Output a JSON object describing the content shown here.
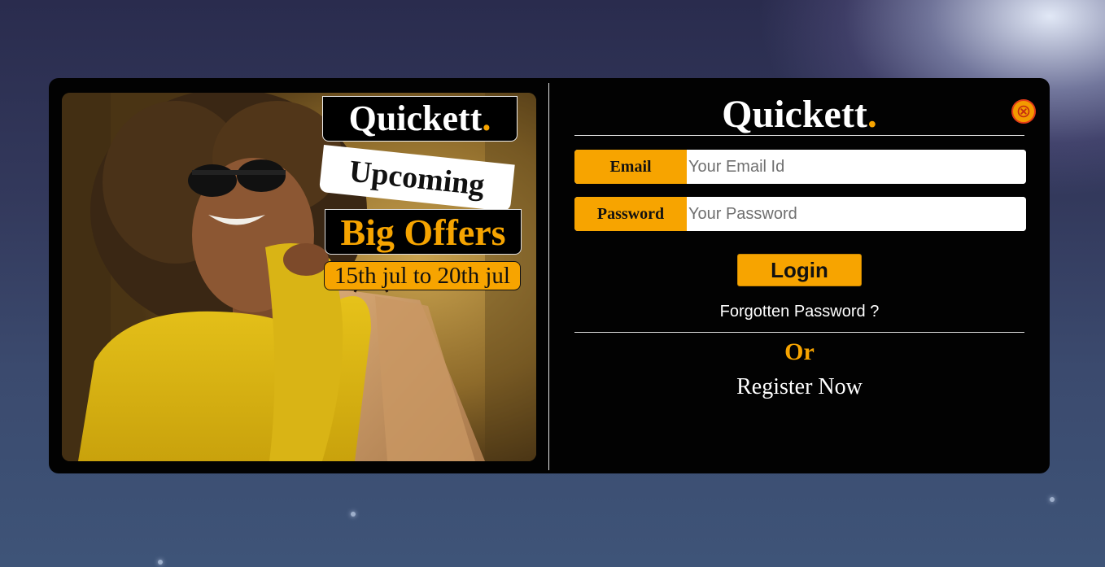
{
  "promo": {
    "brand": "Quickett",
    "brand_dot": ".",
    "headline": "Upcoming",
    "offer": "Big Offers",
    "dates": "15th jul to 20th jul"
  },
  "form": {
    "brand": "Quickett",
    "brand_dot": ".",
    "email_label": "Email",
    "email_placeholder": "Your Email Id",
    "password_label": "Password",
    "password_placeholder": "Your Password",
    "login_label": "Login",
    "forgot_label": "Forgotten Password ?",
    "or_label": "Or",
    "register_label": "Register Now",
    "close_icon": "close-icon"
  },
  "colors": {
    "accent": "#f7a400",
    "panel": "#020202",
    "close_border": "#e23b18"
  }
}
